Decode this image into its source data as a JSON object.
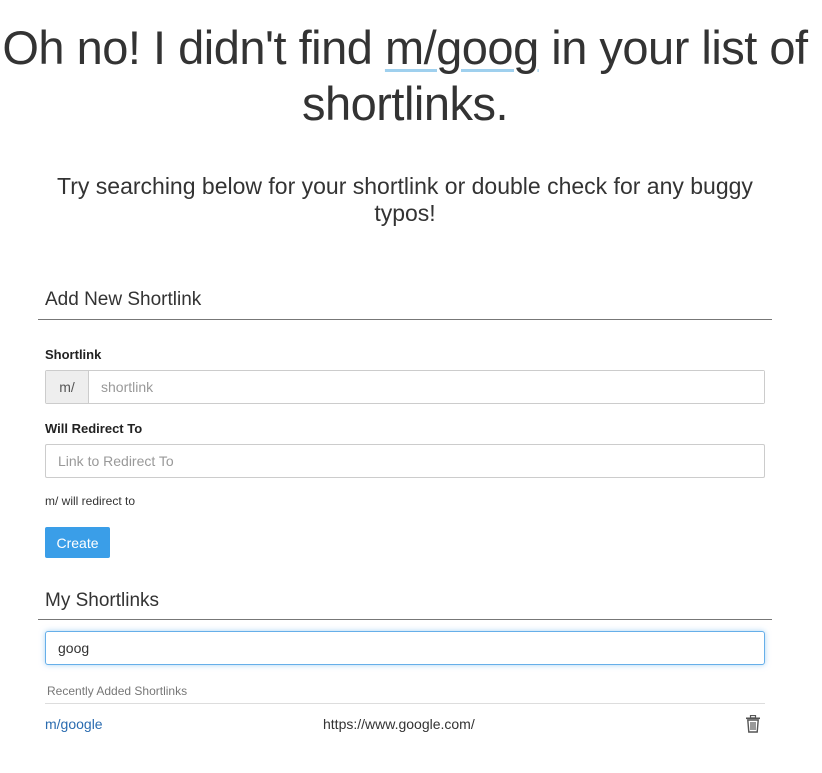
{
  "hero": {
    "title_prefix": "Oh no! I didn't find ",
    "title_link": "m/goog",
    "title_suffix": " in your list of shortlinks.",
    "subtitle": "Try searching below for your shortlink or double check for any buggy typos!"
  },
  "add_section": {
    "title": "Add New Shortlink",
    "shortlink_label": "Shortlink",
    "prefix": "m/",
    "shortlink_placeholder": "shortlink",
    "redirect_label": "Will Redirect To",
    "redirect_placeholder": "Link to Redirect To",
    "helper_text": "m/ will redirect to",
    "create_label": "Create"
  },
  "my_section": {
    "title": "My Shortlinks",
    "search_value": "goog",
    "recent_label": "Recently Added Shortlinks",
    "rows": [
      {
        "shortlink": "m/google",
        "url": "https://www.google.com/"
      }
    ]
  },
  "icons": {
    "delete": "trash-icon"
  },
  "colors": {
    "accent": "#3a9ee8",
    "link": "#2b6cb0",
    "focus": "#66afe9"
  }
}
